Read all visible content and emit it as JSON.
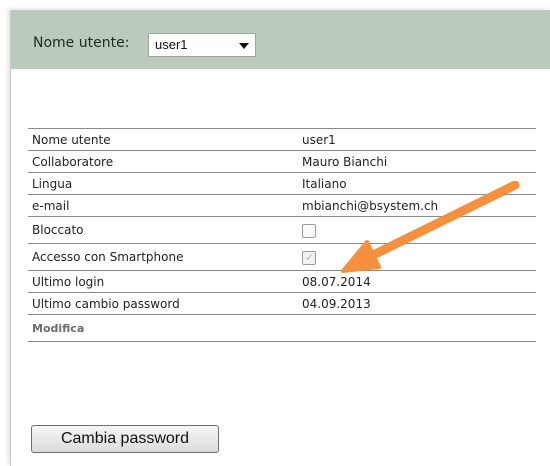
{
  "header": {
    "user_label": "Nome utente:",
    "user_select_value": "user1"
  },
  "details": [
    {
      "label": "Nome utente",
      "value": "user1"
    },
    {
      "label": "Collaboratore",
      "value": "Mauro Bianchi"
    },
    {
      "label": "Lingua",
      "value": "Italiano"
    },
    {
      "label": "e-mail",
      "value": "mbianchi@bsystem.ch"
    },
    {
      "label": "Bloccato",
      "checkbox": true,
      "checked": false
    },
    {
      "label": "Accesso con Smartphone",
      "checkbox": true,
      "checked": true,
      "disabled": true
    },
    {
      "label": "Ultimo login",
      "value": "08.07.2014"
    },
    {
      "label": "Ultimo cambio password",
      "value": "04.09.2013"
    }
  ],
  "edit_link_label": "Modifica",
  "change_password_label": "Cambia password",
  "annotation": {
    "icon": "arrow-annotation-icon",
    "color": "#f5913e"
  }
}
